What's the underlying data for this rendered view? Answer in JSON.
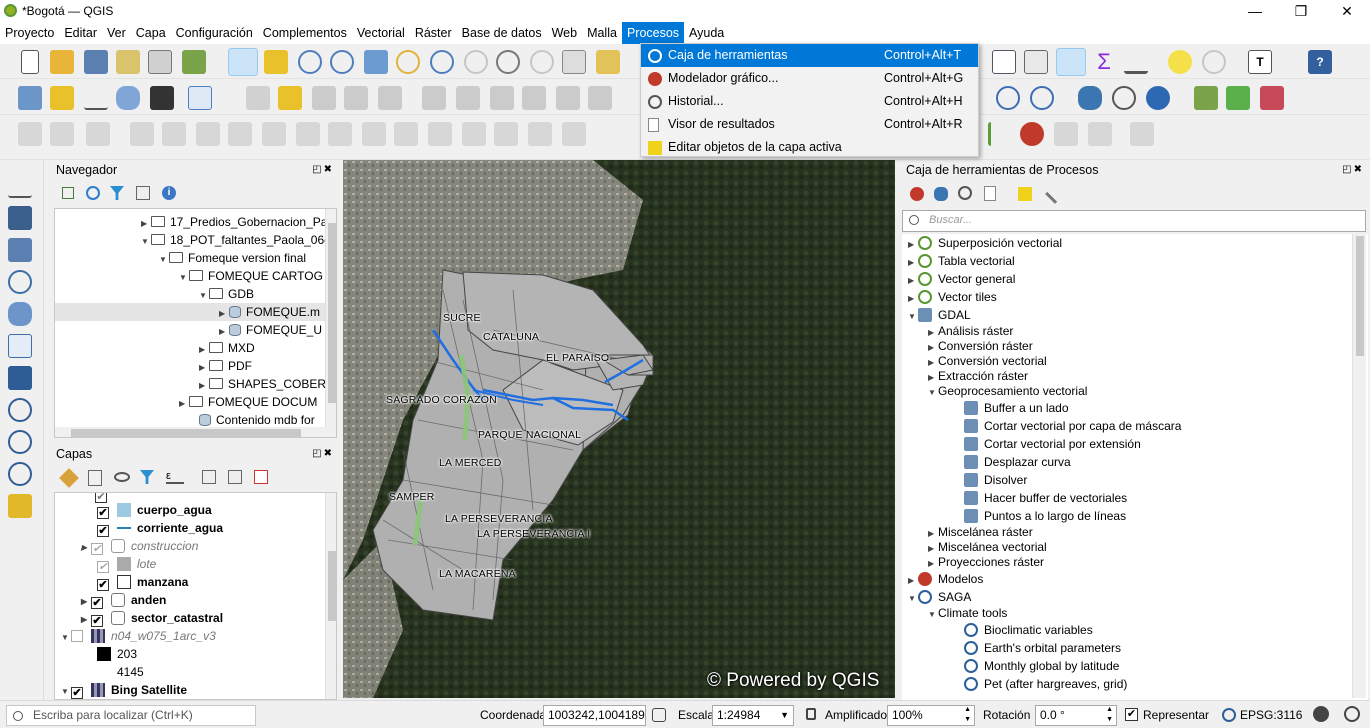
{
  "window": {
    "title": "*Bogotá — QGIS"
  },
  "menubar": [
    "Proyecto",
    "Editar",
    "Ver",
    "Capa",
    "Configuración",
    "Complementos",
    "Vectorial",
    "Ráster",
    "Base de datos",
    "Web",
    "Malla",
    "Procesos",
    "Ayuda"
  ],
  "procesos_menu": [
    {
      "label": "Caja de herramientas",
      "shortcut": "Control+Alt+T"
    },
    {
      "label": "Modelador gráfico...",
      "shortcut": "Control+Alt+G"
    },
    {
      "label": "Historial...",
      "shortcut": "Control+Alt+H"
    },
    {
      "label": "Visor de resultados",
      "shortcut": "Control+Alt+R"
    },
    {
      "label": "Editar objetos de la capa activa",
      "shortcut": ""
    }
  ],
  "navigator": {
    "title": "Navegador",
    "items": [
      "17_Predios_Gobernacion_Pa",
      "18_POT_faltantes_Paola_06c",
      "Fomeque version final",
      "FOMEQUE CARTOG",
      "GDB",
      "FOMEQUE.m",
      "FOMEQUE_U",
      "MXD",
      "PDF",
      "SHAPES_COBER",
      "FOMEQUE DOCUM",
      "Contenido mdb for"
    ]
  },
  "layers": {
    "title": "Capas",
    "items": [
      {
        "name": "cuerpo_agua",
        "symbol_color": "#9ecae1"
      },
      {
        "name": "corriente_agua",
        "symbol_color": "#2c7fb8"
      },
      {
        "name": "construccion",
        "symbol_color": "#ffffff"
      },
      {
        "name": "lote",
        "symbol_color": "#aaaaaa"
      },
      {
        "name": "manzana",
        "symbol_color": "#ffffff"
      },
      {
        "name": "anden",
        "symbol_color": "#ffffff"
      },
      {
        "name": "sector_catastral",
        "symbol_color": "#ffffff"
      },
      {
        "name": "n04_w075_1arc_v3",
        "symbol_color": "#000000"
      },
      {
        "name": "203",
        "symbol_color": "#000000"
      },
      {
        "name": "4145",
        "symbol_color": ""
      },
      {
        "name": "Bing Satellite",
        "symbol_color": ""
      }
    ]
  },
  "map": {
    "labels": [
      "SUCRE",
      "CATALUNA",
      "EL PARAISO",
      "SAGRADO CORAZON",
      "PARQUE NACIONAL",
      "LA MERCED",
      "SAMPER",
      "LA PERSEVERANCIA",
      "LA PERSEVERANCIA I",
      "LA MACARENA"
    ],
    "watermark": "© Powered by QGIS"
  },
  "toolbox": {
    "title": "Caja de herramientas de Procesos",
    "search_placeholder": "Buscar...",
    "items": [
      "Superposición vectorial",
      "Tabla vectorial",
      "Vector general",
      "Vector tiles",
      "GDAL",
      "Análisis ráster",
      "Conversión ráster",
      "Conversión vectorial",
      "Extracción ráster",
      "Geoprocesamiento vectorial",
      "Buffer a un lado",
      "Cortar vectorial por capa de máscara",
      "Cortar vectorial por extensión",
      "Desplazar curva",
      "Disolver",
      "Hacer buffer de vectoriales",
      "Puntos a lo largo de líneas",
      "Miscelánea ráster",
      "Miscelánea vectorial",
      "Proyecciones ráster",
      "Modelos",
      "SAGA",
      "Climate tools",
      "Bioclimatic variables",
      "Earth's orbital parameters",
      "Monthly global by latitude",
      "Pet (after hargreaves, grid)"
    ]
  },
  "statusbar": {
    "locate_placeholder": "Escriba para localizar (Ctrl+K)",
    "coord_label": "Coordenada",
    "coord": "1003242,1004189",
    "scale_label": "Escala",
    "scale": "1:24984",
    "magnifier_label": "Amplificador",
    "magnifier": "100%",
    "rotation_label": "Rotación",
    "rotation": "0.0 °",
    "render_label": "Representar",
    "crs": "EPSG:3116"
  }
}
